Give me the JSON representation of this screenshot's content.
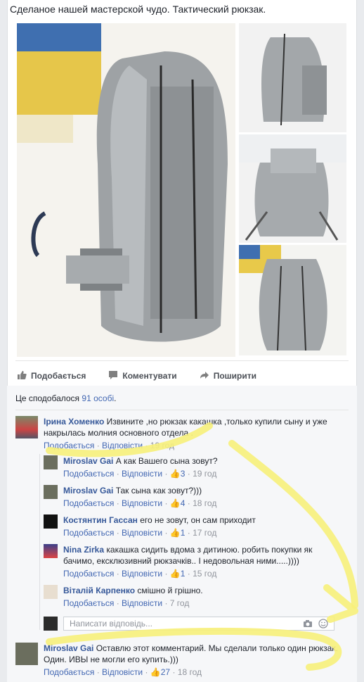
{
  "post": {
    "text": "Сделаное нашей мастерской чудо. Тактический рюкзак."
  },
  "actions": {
    "like": "Подобається",
    "comment": "Коментувати",
    "share": "Поширити"
  },
  "likes_summary": {
    "prefix": "Це сподобалося",
    "count": "91 особі",
    "suffix": "."
  },
  "comments": [
    {
      "name": "Ірина Хоменко",
      "text": "Извините ,но рюкзак какашка ,только купили сыну и уже накрылась молния основного отдела .",
      "like": "Подобається",
      "reply": "Відповісти",
      "time": "19 год"
    },
    {
      "name": "Miroslav Gai",
      "text": "А как Вашего сына зовут?",
      "like": "Подобається",
      "reply": "Відповісти",
      "likes": "3",
      "time": "19 год"
    },
    {
      "name": "Miroslav Gai",
      "text": "Так сына как зовут?)))",
      "like": "Подобається",
      "reply": "Відповісти",
      "likes": "4",
      "time": "18 год"
    },
    {
      "name": "Костянтин Гассан",
      "text": "его не зовут, он сам приходит",
      "like": "Подобається",
      "reply": "Відповісти",
      "likes": "1",
      "time": "17 год"
    },
    {
      "name": "Nina Zirka",
      "text": "какашка сидить вдома з дитиною. робить покупки як бачимо, ексклюзивний рюкзачків.. І недовольная ними.....))))",
      "like": "Подобається",
      "reply": "Відповісти",
      "likes": "1",
      "time": "15 год"
    },
    {
      "name": "Віталій Карпенко",
      "text": "смішно й грішно.",
      "like": "Подобається",
      "reply": "Відповісти",
      "time": "7 год"
    },
    {
      "name": "Miroslav Gai",
      "text": "Оставлю этот комментарий. Мы сделали только один рюкзак. Один. ИВЫ не могли его купить.)))",
      "like": "Подобається",
      "reply": "Відповісти",
      "likes": "27",
      "time": "18 год"
    }
  ],
  "reply_box": {
    "placeholder": "Написати відповідь..."
  },
  "icons": {
    "like": "thumbs-up-icon",
    "comment": "comment-icon",
    "share": "share-icon",
    "camera": "camera-icon",
    "emoji": "emoji-icon"
  },
  "colors": {
    "link": "#365899",
    "highlight": "#f7f07a"
  }
}
